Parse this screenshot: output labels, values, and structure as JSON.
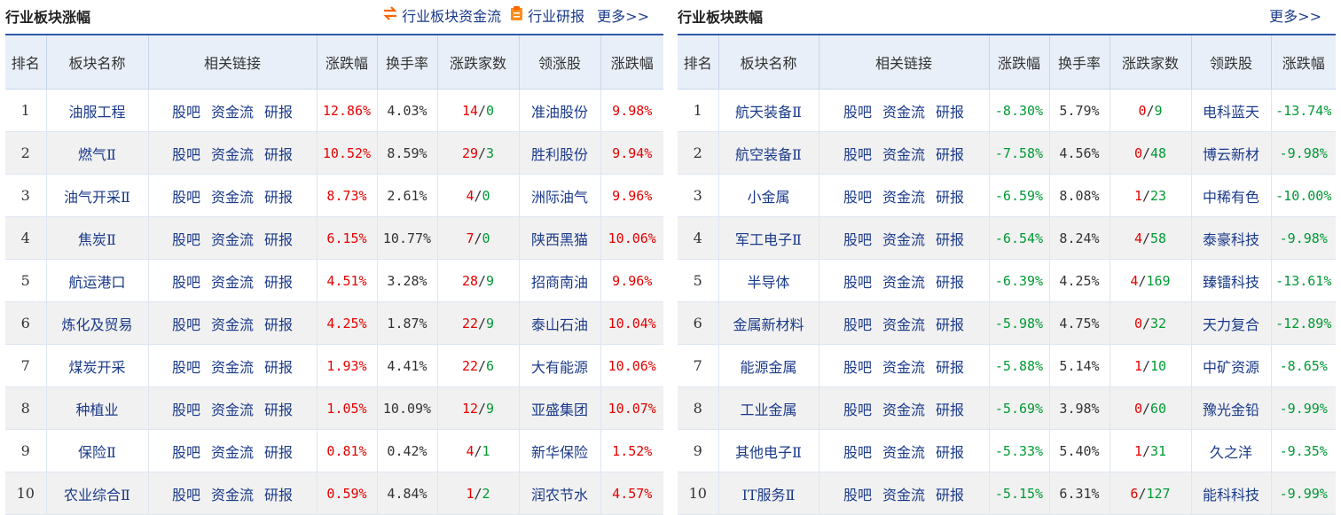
{
  "left": {
    "title": "行业板块涨幅",
    "link_flow": "行业板块资金流",
    "link_report": "行业研报",
    "more": "更多>>",
    "headers": [
      "排名",
      "板块名称",
      "相关链接",
      "涨跌幅",
      "换手率",
      "涨跌家数",
      "领涨股",
      "涨跌幅"
    ],
    "rows": [
      {
        "rank": "1",
        "name": "油服工程",
        "links": [
          "股吧",
          "资金流",
          "研报"
        ],
        "chg": "12.86%",
        "turn": "4.03%",
        "up": "14",
        "down": "0",
        "stock": "准油股份",
        "schg": "9.98%"
      },
      {
        "rank": "2",
        "name": "燃气Ⅱ",
        "links": [
          "股吧",
          "资金流",
          "研报"
        ],
        "chg": "10.52%",
        "turn": "8.59%",
        "up": "29",
        "down": "3",
        "stock": "胜利股份",
        "schg": "9.94%"
      },
      {
        "rank": "3",
        "name": "油气开采Ⅱ",
        "links": [
          "股吧",
          "资金流",
          "研报"
        ],
        "chg": "8.73%",
        "turn": "2.61%",
        "up": "4",
        "down": "0",
        "stock": "洲际油气",
        "schg": "9.96%"
      },
      {
        "rank": "4",
        "name": "焦炭Ⅱ",
        "links": [
          "股吧",
          "资金流",
          "研报"
        ],
        "chg": "6.15%",
        "turn": "10.77%",
        "up": "7",
        "down": "0",
        "stock": "陕西黑猫",
        "schg": "10.06%"
      },
      {
        "rank": "5",
        "name": "航运港口",
        "links": [
          "股吧",
          "资金流",
          "研报"
        ],
        "chg": "4.51%",
        "turn": "3.28%",
        "up": "28",
        "down": "9",
        "stock": "招商南油",
        "schg": "9.96%"
      },
      {
        "rank": "6",
        "name": "炼化及贸易",
        "links": [
          "股吧",
          "资金流",
          "研报"
        ],
        "chg": "4.25%",
        "turn": "1.87%",
        "up": "22",
        "down": "9",
        "stock": "泰山石油",
        "schg": "10.04%"
      },
      {
        "rank": "7",
        "name": "煤炭开采",
        "links": [
          "股吧",
          "资金流",
          "研报"
        ],
        "chg": "1.93%",
        "turn": "4.41%",
        "up": "22",
        "down": "6",
        "stock": "大有能源",
        "schg": "10.06%"
      },
      {
        "rank": "8",
        "name": "种植业",
        "links": [
          "股吧",
          "资金流",
          "研报"
        ],
        "chg": "1.05%",
        "turn": "10.09%",
        "up": "12",
        "down": "9",
        "stock": "亚盛集团",
        "schg": "10.07%"
      },
      {
        "rank": "9",
        "name": "保险Ⅱ",
        "links": [
          "股吧",
          "资金流",
          "研报"
        ],
        "chg": "0.81%",
        "turn": "0.42%",
        "up": "4",
        "down": "1",
        "stock": "新华保险",
        "schg": "1.52%"
      },
      {
        "rank": "10",
        "name": "农业综合Ⅱ",
        "links": [
          "股吧",
          "资金流",
          "研报"
        ],
        "chg": "0.59%",
        "turn": "4.84%",
        "up": "1",
        "down": "2",
        "stock": "润农节水",
        "schg": "4.57%"
      }
    ]
  },
  "right": {
    "title": "行业板块跌幅",
    "more": "更多>>",
    "headers": [
      "排名",
      "板块名称",
      "相关链接",
      "涨跌幅",
      "换手率",
      "涨跌家数",
      "领跌股",
      "涨跌幅"
    ],
    "rows": [
      {
        "rank": "1",
        "name": "航天装备Ⅱ",
        "links": [
          "股吧",
          "资金流",
          "研报"
        ],
        "chg": "-8.30%",
        "turn": "5.79%",
        "up": "0",
        "down": "9",
        "stock": "电科蓝天",
        "schg": "-13.74%"
      },
      {
        "rank": "2",
        "name": "航空装备Ⅱ",
        "links": [
          "股吧",
          "资金流",
          "研报"
        ],
        "chg": "-7.58%",
        "turn": "4.56%",
        "up": "0",
        "down": "48",
        "stock": "博云新材",
        "schg": "-9.98%"
      },
      {
        "rank": "3",
        "name": "小金属",
        "links": [
          "股吧",
          "资金流",
          "研报"
        ],
        "chg": "-6.59%",
        "turn": "8.08%",
        "up": "1",
        "down": "23",
        "stock": "中稀有色",
        "schg": "-10.00%"
      },
      {
        "rank": "4",
        "name": "军工电子Ⅱ",
        "links": [
          "股吧",
          "资金流",
          "研报"
        ],
        "chg": "-6.54%",
        "turn": "8.24%",
        "up": "4",
        "down": "58",
        "stock": "泰豪科技",
        "schg": "-9.98%"
      },
      {
        "rank": "5",
        "name": "半导体",
        "links": [
          "股吧",
          "资金流",
          "研报"
        ],
        "chg": "-6.39%",
        "turn": "4.25%",
        "up": "4",
        "down": "169",
        "stock": "臻镭科技",
        "schg": "-13.61%"
      },
      {
        "rank": "6",
        "name": "金属新材料",
        "links": [
          "股吧",
          "资金流",
          "研报"
        ],
        "chg": "-5.98%",
        "turn": "4.75%",
        "up": "0",
        "down": "32",
        "stock": "天力复合",
        "schg": "-12.89%"
      },
      {
        "rank": "7",
        "name": "能源金属",
        "links": [
          "股吧",
          "资金流",
          "研报"
        ],
        "chg": "-5.88%",
        "turn": "5.14%",
        "up": "1",
        "down": "10",
        "stock": "中矿资源",
        "schg": "-8.65%"
      },
      {
        "rank": "8",
        "name": "工业金属",
        "links": [
          "股吧",
          "资金流",
          "研报"
        ],
        "chg": "-5.69%",
        "turn": "3.98%",
        "up": "0",
        "down": "60",
        "stock": "豫光金铅",
        "schg": "-9.99%"
      },
      {
        "rank": "9",
        "name": "其他电子Ⅱ",
        "links": [
          "股吧",
          "资金流",
          "研报"
        ],
        "chg": "-5.33%",
        "turn": "5.40%",
        "up": "1",
        "down": "31",
        "stock": "久之洋",
        "schg": "-9.35%"
      },
      {
        "rank": "10",
        "name": "IT服务Ⅱ",
        "links": [
          "股吧",
          "资金流",
          "研报"
        ],
        "chg": "-5.15%",
        "turn": "6.31%",
        "up": "6",
        "down": "127",
        "stock": "能科科技",
        "schg": "-9.99%"
      }
    ]
  },
  "colors": {
    "up": "#e60000",
    "down": "#009933",
    "link": "#1a3a8a",
    "header_bg": "#e8eff9",
    "accent": "#2e5aa8",
    "flow_icon": "#ff6600"
  }
}
